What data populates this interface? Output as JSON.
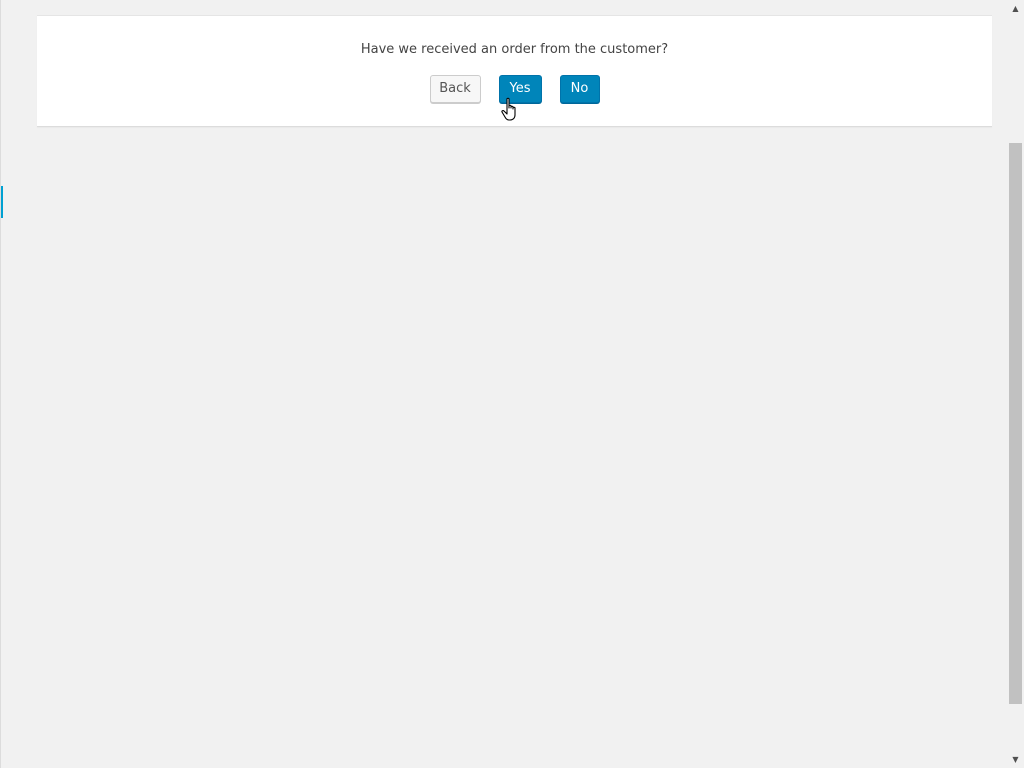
{
  "dialog": {
    "question": "Have we received an order from the customer?",
    "buttons": {
      "back_label": "Back",
      "yes_label": "Yes",
      "no_label": "No"
    }
  },
  "colors": {
    "primary": "#0085ba",
    "primary_border": "#0073aa",
    "secondary_bg": "#f7f7f7",
    "page_bg": "#f1f1f1",
    "panel_bg": "#ffffff",
    "accent": "#00a0d2"
  },
  "icons": {
    "cursor": "hand-pointer-icon",
    "scroll_up": "scroll-up-arrow-icon",
    "scroll_down": "scroll-down-arrow-icon"
  }
}
